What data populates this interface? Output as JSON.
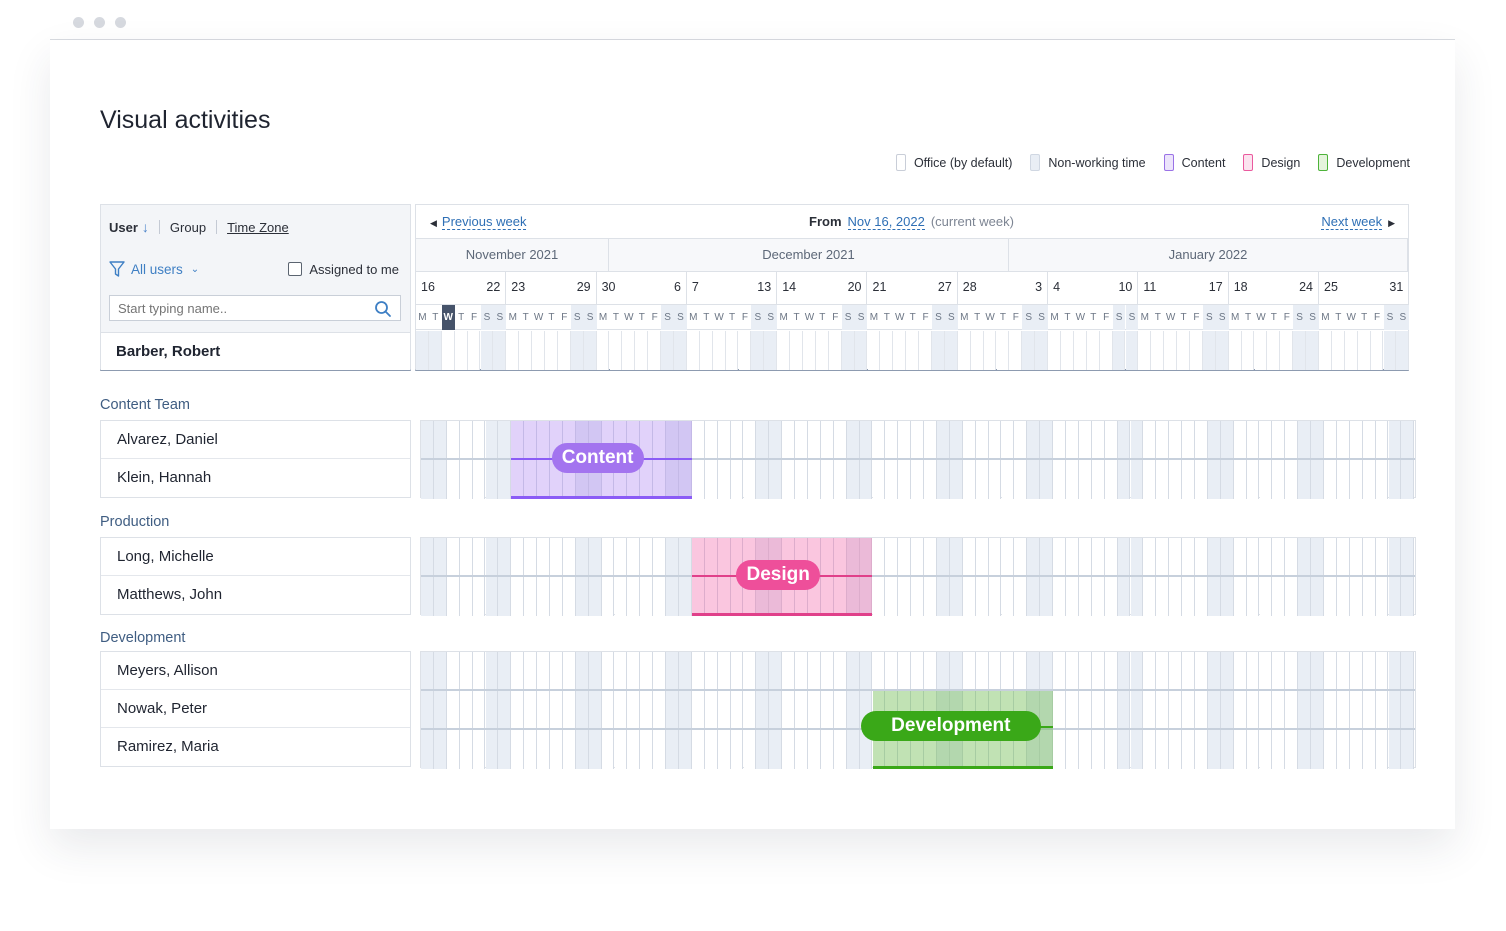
{
  "page": {
    "title": "Visual activities"
  },
  "legend": [
    {
      "label": "Office (by default)",
      "fill": "#ffffff",
      "border": "#c9ced8"
    },
    {
      "label": "Non-working time",
      "fill": "#e9eef5",
      "border": "#d0d7e2"
    },
    {
      "label": "Content",
      "fill": "#ece4fb",
      "border": "#9a72e6"
    },
    {
      "label": "Design",
      "fill": "#fbe3ef",
      "border": "#ea5a9e"
    },
    {
      "label": "Development",
      "fill": "#e5f4dd",
      "border": "#4db33a"
    }
  ],
  "panel": {
    "tabs": {
      "user": "User",
      "group": "Group",
      "timezone": "Time Zone"
    },
    "all_users": "All users",
    "assigned_to_me": "Assigned to me",
    "search_placeholder": "Start typing name..",
    "current_user": "Barber, Robert"
  },
  "nav": {
    "previous": "Previous week",
    "from_label": "From",
    "from_date": "Nov 16, 2022",
    "current_note": "(current week)",
    "next": "Next week"
  },
  "months": [
    "November 2021",
    "December 2021",
    "January 2022"
  ],
  "weeks": [
    [
      "16",
      "22"
    ],
    [
      "23",
      "29"
    ],
    [
      "30",
      "6"
    ],
    [
      "7",
      "13"
    ],
    [
      "14",
      "20"
    ],
    [
      "21",
      "27"
    ],
    [
      "28",
      "3"
    ],
    [
      "4",
      "10"
    ],
    [
      "11",
      "17"
    ],
    [
      "18",
      "24"
    ],
    [
      "25",
      "31"
    ]
  ],
  "weekday_letters": [
    "M",
    "T",
    "W",
    "T",
    "F",
    "S",
    "S"
  ],
  "groups": [
    {
      "label": "Content Team",
      "members": [
        "Alvarez, Daniel",
        "Klein, Hannah"
      ],
      "activity": {
        "label": "Content",
        "type": "Content",
        "color": "#a374ef"
      }
    },
    {
      "label": "Production",
      "members": [
        "Long, Michelle",
        "Matthews, John"
      ],
      "activity": {
        "label": "Design",
        "type": "Design",
        "color": "#ee4f9a"
      }
    },
    {
      "label": "Development",
      "members": [
        "Meyers, Allison",
        "Nowak, Peter",
        "Ramirez, Maria"
      ],
      "activity": {
        "label": "Development",
        "type": "Development",
        "color": "#3aa818"
      }
    }
  ]
}
